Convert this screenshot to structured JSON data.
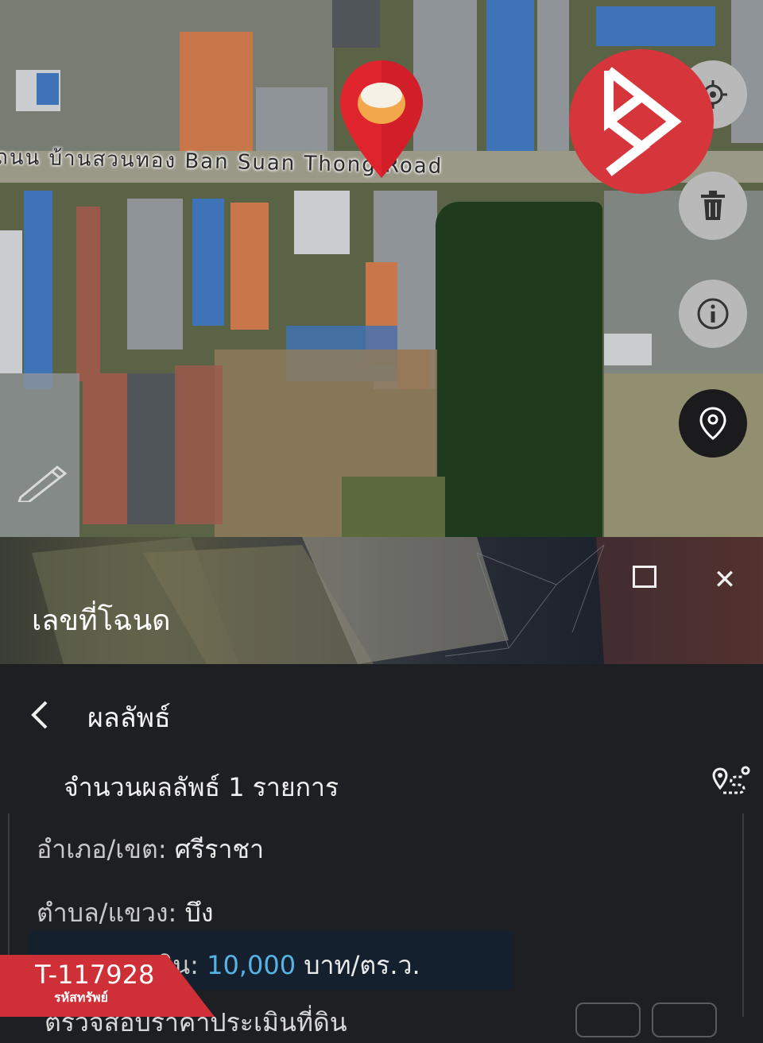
{
  "map": {
    "road_label": "ถนน บ้านสวนทอง Ban Suan Thong Road"
  },
  "fab": {
    "location": "gps-target-icon",
    "delete": "trash-icon",
    "info": "info-icon",
    "pin": "map-pin-icon"
  },
  "brand": {
    "icon": "brand-b-logo-icon",
    "color": "#d6353b"
  },
  "panel": {
    "title": "เลขที่โฉนด"
  },
  "results": {
    "title": "ผลลัพธ์",
    "count_label": "จำนวนผลลัพธ์ 1 รายการ",
    "items": [
      {
        "district_label": "อำเภอ/เขต:",
        "district_value": "ศรีราชา",
        "subdistrict_label": "ตำบล/แขวง:",
        "subdistrict_value": "บึง",
        "price_label": "ราคาประเมิน:",
        "price_value": "10,000",
        "price_unit": "บาท/ตร.ว.",
        "next_label": "ตรวจสอบราคาประเมินที่ดิน"
      }
    ]
  },
  "watermark": {
    "code": "T-117928",
    "caption": "รหัสทรัพย์",
    "color": "#cf3037"
  },
  "colors": {
    "accent_blue": "#57b3e6",
    "pin_red": "#e0242e"
  }
}
